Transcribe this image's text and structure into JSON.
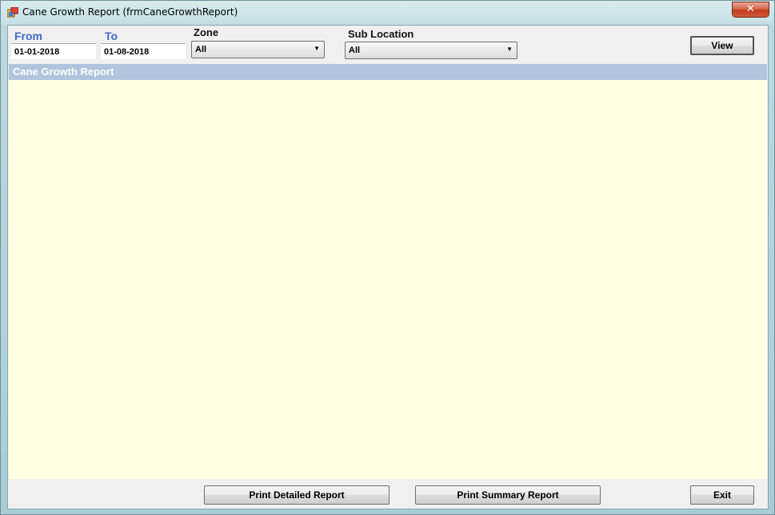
{
  "window": {
    "title": "Cane Growth Report (frmCaneGrowthReport)",
    "close_glyph": "✕"
  },
  "filters": {
    "from_label": "From",
    "from_value": "01-01-2018",
    "to_label": "To",
    "to_value": "01-08-2018",
    "zone_label": "Zone",
    "zone_value": "All",
    "sublocation_label": "Sub Location",
    "sublocation_value": "All",
    "view_label": "View"
  },
  "report": {
    "header": "Cane Growth Report"
  },
  "footer": {
    "print_detailed_label": "Print Detailed Report",
    "print_summary_label": "Print Summary Report",
    "exit_label": "Exit"
  },
  "colors": {
    "report_header_bg": "#b0c4de",
    "report_area_bg": "#ffffe3",
    "label_blue": "#4169c6"
  }
}
